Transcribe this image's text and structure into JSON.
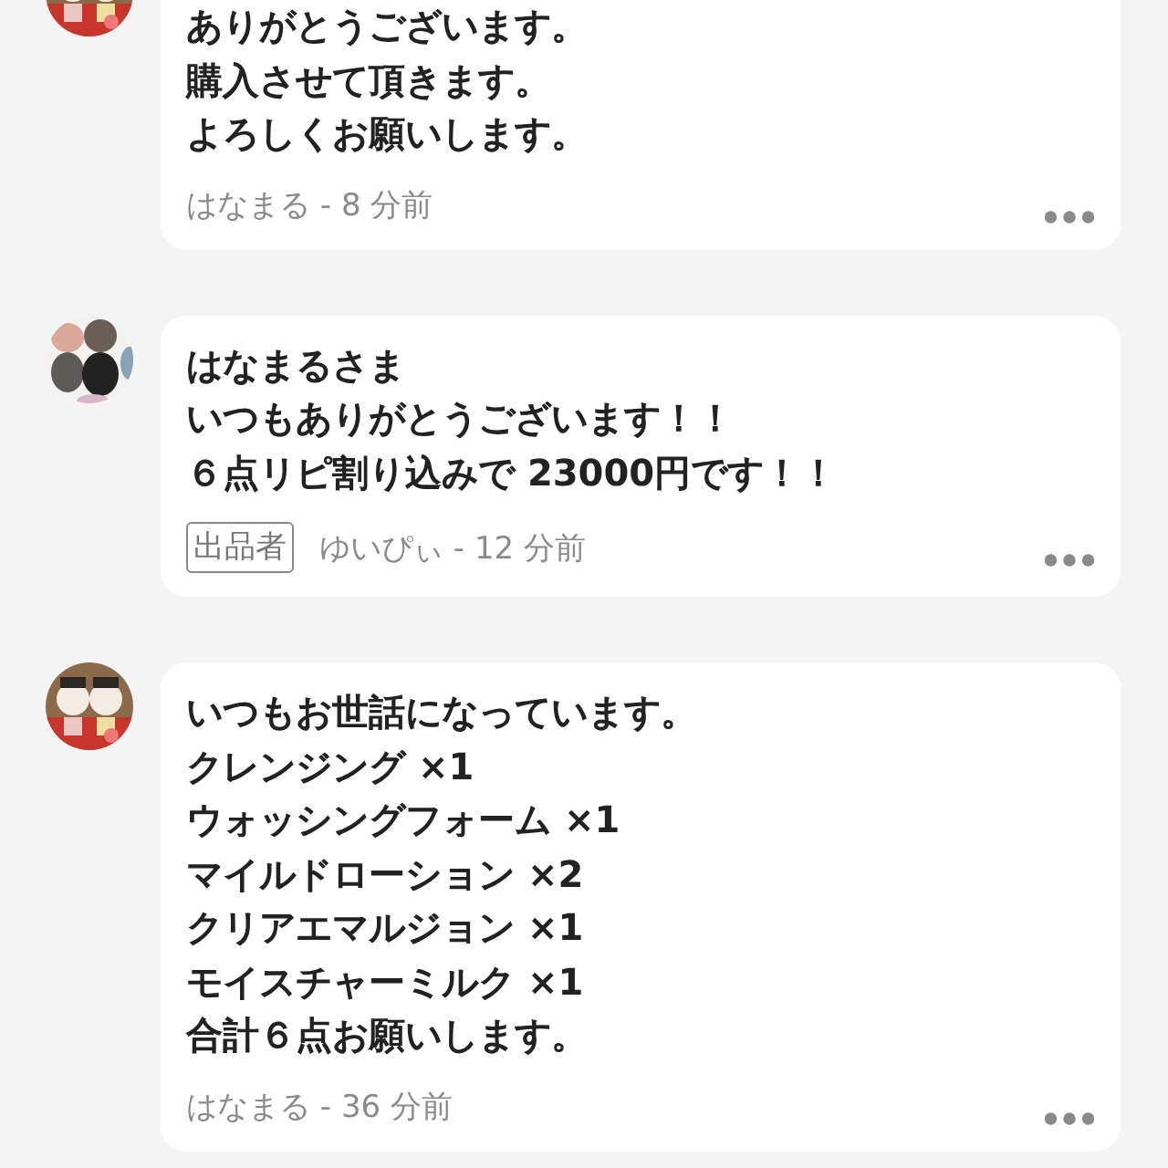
{
  "comments": [
    {
      "lines": [
        "ありがとうございます。",
        "購入させて頂きます。",
        "よろしくお願いします。"
      ],
      "meta": "はなまる - 8 分前"
    },
    {
      "lines": [
        "はなまるさま",
        "いつもありがとうございます！！",
        "６点リピ割り込みで 23000円です！！"
      ],
      "seller_badge": "出品者",
      "meta": "ゆいぴぃ - 12 分前"
    },
    {
      "lines": [
        "いつもお世話になっています。",
        "クレンジング ×1",
        "ウォッシングフォーム ×1",
        "マイルドローション ×2",
        "クリアエマルジョン ×1",
        "モイスチャーミルク ×1",
        "合計６点お願いします。"
      ],
      "meta": "はなまる - 36 分前"
    }
  ]
}
